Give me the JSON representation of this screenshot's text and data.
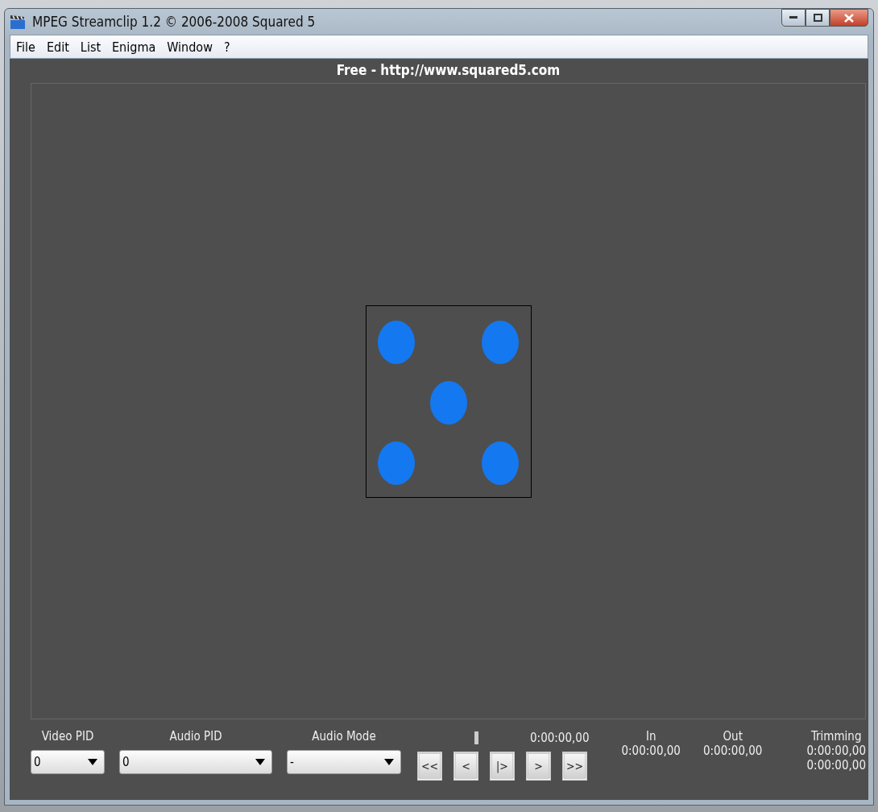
{
  "window": {
    "title": "MPEG Streamclip 1.2  ©  2006-2008 Squared 5"
  },
  "menu": [
    "File",
    "Edit",
    "List",
    "Enigma",
    "Window",
    "?"
  ],
  "banner": "Free  -  http://www.squared5.com",
  "controls": {
    "video_pid": {
      "label": "Video PID",
      "value": "0"
    },
    "audio_pid": {
      "label": "Audio PID",
      "value": "0"
    },
    "audio_mode": {
      "label": "Audio Mode",
      "value": "-"
    },
    "time": "0:00:00,00",
    "buttons": [
      "<<",
      "<",
      "|>",
      ">",
      ">>"
    ],
    "in": {
      "label": "In",
      "value": "0:00:00,00"
    },
    "out": {
      "label": "Out",
      "value": "0:00:00,00"
    },
    "trimming": {
      "label": "Trimming",
      "values": [
        "0:00:00,00",
        "0:00:00,00"
      ]
    }
  }
}
